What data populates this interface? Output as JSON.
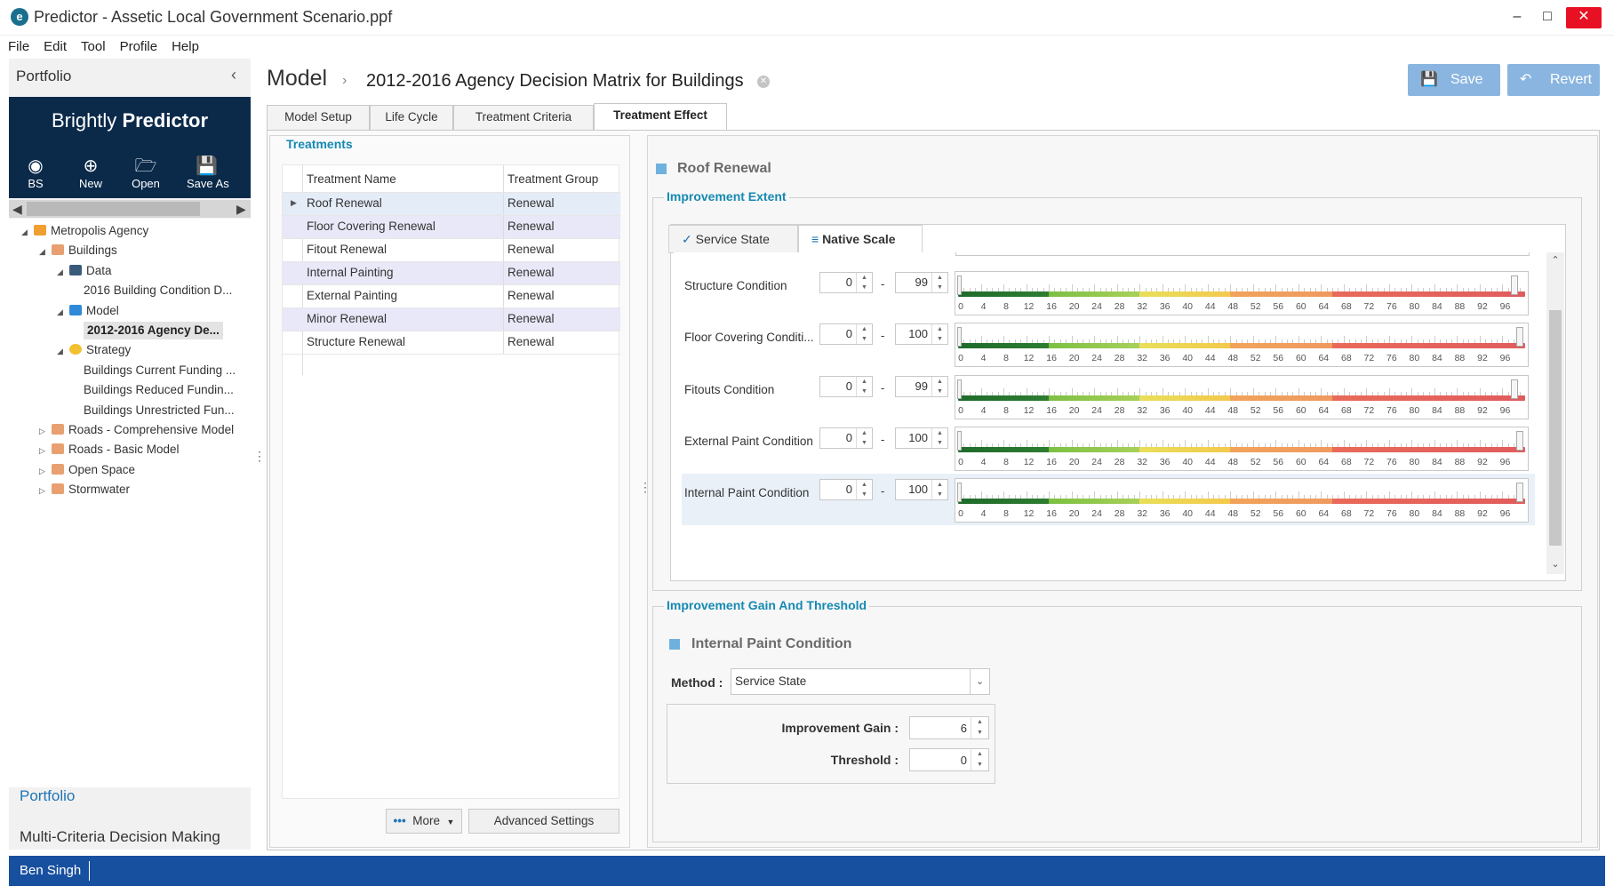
{
  "window": {
    "title": "Predictor - Assetic Local Government Scenario.ppf",
    "logo": "e",
    "minimize": "–",
    "maximize": "□",
    "close": "✕"
  },
  "menu": [
    "File",
    "Edit",
    "Tool",
    "Profile",
    "Help"
  ],
  "sidebar": {
    "header": "Portfolio",
    "brand_light": "Brightly",
    "brand_bold": "Predictor",
    "toolbar": [
      {
        "label": "BS",
        "icon": "user-icon"
      },
      {
        "label": "New",
        "icon": "plus-circle-icon"
      },
      {
        "label": "Open",
        "icon": "folder-open-icon"
      },
      {
        "label": "Save As",
        "icon": "save-icon"
      }
    ],
    "tree": [
      {
        "label": "Metropolis Agency",
        "level": 0,
        "expanded": true,
        "icon": "agency-icon"
      },
      {
        "label": "Buildings",
        "level": 1,
        "expanded": true,
        "icon": "asset-class-icon"
      },
      {
        "label": "Data",
        "level": 2,
        "expanded": true,
        "icon": "database-icon"
      },
      {
        "label": "2016 Building Condition D...",
        "level": 3,
        "icon": ""
      },
      {
        "label": "Model",
        "level": 2,
        "expanded": true,
        "icon": "bar-chart-icon"
      },
      {
        "label": "2012-2016 Agency De...",
        "level": 3,
        "icon": "",
        "selected": true
      },
      {
        "label": "Strategy",
        "level": 2,
        "expanded": true,
        "icon": "strategy-icon"
      },
      {
        "label": "Buildings Current Funding ...",
        "level": 3,
        "icon": ""
      },
      {
        "label": "Buildings Reduced Fundin...",
        "level": 3,
        "icon": ""
      },
      {
        "label": "Buildings Unrestricted Fun...",
        "level": 3,
        "icon": ""
      },
      {
        "label": "Roads - Comprehensive Model",
        "level": 1,
        "expanded": false,
        "icon": "asset-class-icon"
      },
      {
        "label": "Roads - Basic Model",
        "level": 1,
        "expanded": false,
        "icon": "asset-class-icon"
      },
      {
        "label": "Open Space",
        "level": 1,
        "expanded": false,
        "icon": "asset-class-icon"
      },
      {
        "label": "Stormwater",
        "level": 1,
        "expanded": false,
        "icon": "asset-class-icon"
      }
    ],
    "nav_portfolio": "Portfolio",
    "nav_mcdm": "Multi-Criteria Decision Making"
  },
  "status": {
    "user": "Ben Singh"
  },
  "header": {
    "section": "Model",
    "title": "2012-2016 Agency Decision Matrix for Buildings",
    "save": "Save",
    "revert": "Revert"
  },
  "tabs": [
    "Model Setup",
    "Life Cycle",
    "Treatment Criteria",
    "Treatment Effect"
  ],
  "active_tab": "Treatment Effect",
  "treatments": {
    "title": "Treatments",
    "columns": [
      "Treatment Name",
      "Treatment Group"
    ],
    "rows": [
      {
        "name": "Roof Renewal",
        "group": "Renewal"
      },
      {
        "name": "Floor Covering Renewal",
        "group": "Renewal"
      },
      {
        "name": "Fitout Renewal",
        "group": "Renewal"
      },
      {
        "name": "Internal Painting",
        "group": "Renewal"
      },
      {
        "name": "External Painting",
        "group": "Renewal"
      },
      {
        "name": "Minor Renewal",
        "group": "Renewal"
      },
      {
        "name": "Structure  Renewal",
        "group": "Renewal"
      }
    ],
    "more": "More",
    "advanced": "Advanced Settings"
  },
  "effect": {
    "treatment": "Roof Renewal",
    "extent_title": "Improvement Extent",
    "subtabs": [
      "Service State",
      "Native Scale"
    ],
    "active_subtab": "Native Scale",
    "scale_labels": [
      "0",
      "4",
      "8",
      "12",
      "16",
      "20",
      "24",
      "28",
      "32",
      "36",
      "40",
      "44",
      "48",
      "52",
      "56",
      "60",
      "64",
      "68",
      "72",
      "76",
      "80",
      "84",
      "88",
      "92",
      "96"
    ],
    "conditions": [
      {
        "label": "Structure Condition",
        "min": "0",
        "max": "99"
      },
      {
        "label": "Floor Covering Conditi...",
        "min": "0",
        "max": "100"
      },
      {
        "label": "Fitouts Condition",
        "min": "0",
        "max": "99"
      },
      {
        "label": "External Paint Condition",
        "min": "0",
        "max": "100"
      },
      {
        "label": "Internal Paint Condition",
        "min": "0",
        "max": "100"
      }
    ],
    "gain_title": "Improvement Gain And Threshold",
    "gain_condition": "Internal Paint Condition",
    "method_label": "Method :",
    "method_value": "Service State",
    "gain_label": "Improvement Gain :",
    "gain_value": "6",
    "threshold_label": "Threshold :",
    "threshold_value": "0"
  },
  "colors": {
    "brand": "#0b2a4a",
    "status": "#1850a0",
    "accent": "#1589b3",
    "button": "#8ab5e0"
  }
}
